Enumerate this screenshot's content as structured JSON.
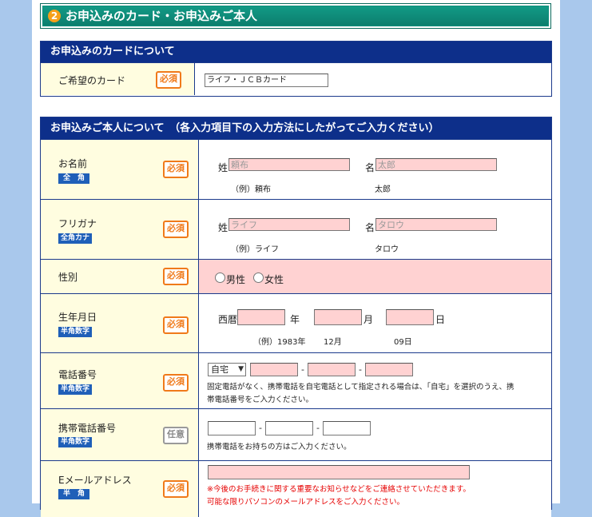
{
  "section": {
    "number": "2",
    "title": "お申込みのカード・お申込みご本人"
  },
  "card_table": {
    "header": "お申込みのカードについて",
    "row_label": "ご希望のカード",
    "required": "必須",
    "card_value": "ライフ・ＪＣＢカード"
  },
  "person_table": {
    "header": "お申込みご本人について　（各入力項目下の入力方法にしたがってご入力ください）",
    "name": {
      "label": "お名前",
      "tag": "全　角",
      "required": "必須",
      "sei_label": "姓",
      "sei_placeholder": "頼布",
      "mei_label": "名",
      "mei_placeholder": "太郎",
      "example_sei": "（例）頼布",
      "example_mei": "太郎"
    },
    "kana": {
      "label": "フリガナ",
      "tag": "全角カナ",
      "required": "必須",
      "sei_label": "姓",
      "sei_placeholder": "ライフ",
      "mei_label": "名",
      "mei_placeholder": "タロウ",
      "example_sei": "（例）ライフ",
      "example_mei": "タロウ"
    },
    "gender": {
      "label": "性別",
      "required": "必須",
      "male": "男性",
      "female": "女性"
    },
    "birthday": {
      "label": "生年月日",
      "tag": "半角数字",
      "required": "必須",
      "era": "西暦",
      "year": "年",
      "month": "月",
      "day": "日",
      "example_year": "（例）1983年",
      "example_month": "12月",
      "example_day": "09日"
    },
    "phone": {
      "label": "電話番号",
      "tag": "半角数字",
      "required": "必須",
      "select_value": "自宅",
      "dash": "-",
      "note_line1": "固定電話がなく、携帯電話を自宅電話として指定される場合は、「自宅」を選択のうえ、携",
      "note_line2": "帯電話番号をご入力ください。"
    },
    "mobile": {
      "label": "携帯電話番号",
      "tag": "半角数字",
      "optional": "任意",
      "dash": "-",
      "note": "携帯電話をお持ちの方はご入力ください。"
    },
    "email": {
      "label": "Eメールアドレス",
      "tag": "半　角",
      "required": "必須",
      "note_line1": "※今後のお手続きに関する重要なお知らせなどをご連絡させていただきます。",
      "note_line2": "可能な限りパソコンのメールアドレスをご入力ください。"
    }
  },
  "colors": {
    "background": "#a9c8ec",
    "header_navy": "#0d2f8a",
    "section_teal": "#0f8f7c",
    "label_bg": "#fffde0",
    "input_pink": "#ffd2d2",
    "required_orange": "#f07a1a",
    "tag_blue": "#1f5fb8"
  }
}
